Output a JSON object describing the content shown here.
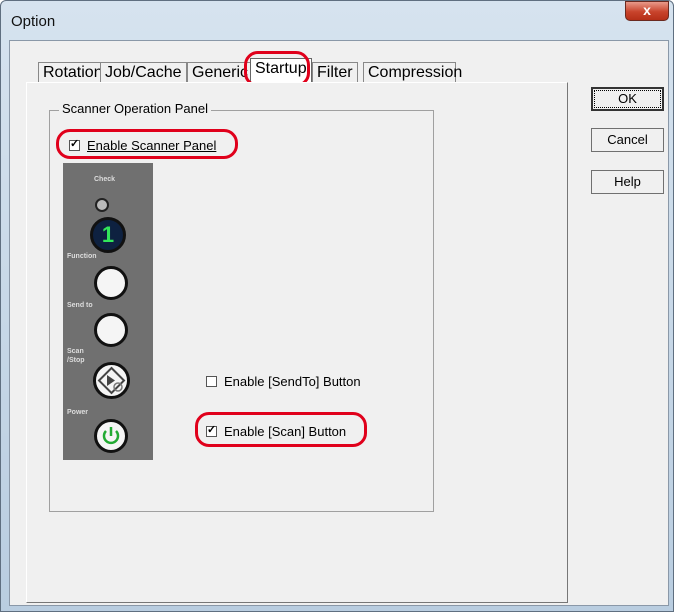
{
  "window": {
    "title": "Option",
    "close_glyph": "x"
  },
  "tabs": [
    "Rotation",
    "Job/Cache",
    "Generic",
    "Startup",
    "Filter",
    "Compression"
  ],
  "group": {
    "label": "Scanner Operation Panel",
    "enable_scanner_panel": {
      "label": "Enable Scanner Panel",
      "checked": true
    },
    "enable_sendto": {
      "label": "Enable [SendTo] Button",
      "checked": false
    },
    "enable_scan": {
      "label": "Enable [Scan] Button",
      "checked": true
    }
  },
  "panel_labels": {
    "check": "Check",
    "function": "Function",
    "send_to": "Send to",
    "scan_stop": "Scan /Stop",
    "power": "Power",
    "display": "1"
  },
  "buttons": {
    "ok": "OK",
    "cancel": "Cancel",
    "help": "Help"
  },
  "colors": {
    "highlight": "#e0001b",
    "display_digit": "#32e65a",
    "power_icon": "#22aa33"
  }
}
